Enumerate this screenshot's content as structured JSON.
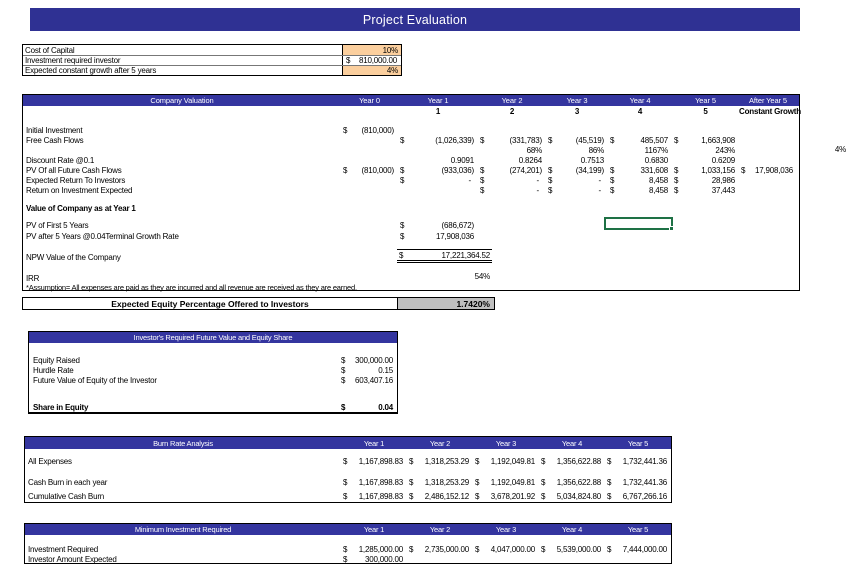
{
  "currency": "$",
  "title_bar": {
    "label": "Project Evaluation"
  },
  "assumptions": {
    "rows": [
      {
        "label": "Cost of Capital",
        "value": "10%"
      },
      {
        "label": "Investment required investor",
        "value": "810,000.00"
      },
      {
        "label": "Expected constant growth after 5 years",
        "value": "4%"
      }
    ]
  },
  "valuation": {
    "title": "Company Valuation",
    "years": [
      "Year 0",
      "Year 1",
      "Year 2",
      "Year 3",
      "Year 4",
      "Year 5",
      "After Year 5"
    ],
    "year_numbers": [
      "1",
      "2",
      "3",
      "4",
      "5"
    ],
    "constant_growth_label": "Constant Growth",
    "initial_investment": {
      "label": "Initial Investment",
      "y0": "(810,000)"
    },
    "free_cash_flows": {
      "label": "Free Cash Flows",
      "y1": "(1,026,339)",
      "y2": "(331,783)",
      "y3": "(45,519)",
      "y4": "485,507",
      "y5": "1,663,908"
    },
    "growth_percents": {
      "y2": "68%",
      "y3": "86%",
      "y4": "1167%",
      "y5": "243%",
      "after": "4%"
    },
    "discount_rate": {
      "label": "Discount Rate @0.1",
      "y1": "0.9091",
      "y2": "0.8264",
      "y3": "0.7513",
      "y4": "0.6830",
      "y5": "0.6209"
    },
    "pv_future": {
      "label": "PV Of all Future Cash Flows",
      "y0": "(810,000)",
      "y1": "(933,036)",
      "y2": "(274,201)",
      "y3": "(34,199)",
      "y4": "331,608",
      "y5": "1,033,156",
      "after": "17,908,036"
    },
    "expected_return": {
      "label": "Expected Return To Investors",
      "y1": "-",
      "y2": "-",
      "y3": "-",
      "y4": "8,458",
      "y5": "28,986"
    },
    "roi_expected": {
      "label": "Return on Investment Expected",
      "y2": "-",
      "y3": "-",
      "y4": "8,458",
      "y5": "37,443"
    },
    "value_heading": "Value of Company as at Year 1",
    "pv_first5": {
      "label": "PV of First 5 Years",
      "y1": "(686,672)"
    },
    "pv_after5": {
      "label": "PV after 5 Years @0.04Terminal Growth Rate",
      "y1": "17,908,036"
    },
    "npw": {
      "label": "NPW Value of the Company",
      "value": "17,221,364.52"
    },
    "irr": {
      "label": "IRR",
      "value": "54%"
    },
    "note": "*Assumption= All expenses are paid as they are incurred and all revenue are received as they are earned."
  },
  "equity_offer": {
    "label": "Expected Equity Percentage Offered to Investors",
    "value": "1.7420%"
  },
  "investor": {
    "title": "Investor's Required Future Value and Equity Share",
    "rows": [
      {
        "label": "Equity Raised",
        "value": "300,000.00"
      },
      {
        "label": "Hurdle Rate",
        "value": "0.15"
      },
      {
        "label": "Future Value of Equity of the Investor",
        "value": "603,407.16"
      }
    ],
    "total": {
      "label": "Share in Equity",
      "value": "0.04"
    }
  },
  "burn_rate": {
    "title": "Burn Rate Analysis",
    "years": [
      "Year 1",
      "Year 2",
      "Year 3",
      "Year 4",
      "Year 5"
    ],
    "rows": [
      {
        "label": "All Expenses",
        "values": [
          "1,167,898.83",
          "1,318,253.29",
          "1,192,049.81",
          "1,356,622.88",
          "1,732,441.36"
        ]
      },
      {
        "label": "Cash Burn in each year",
        "values": [
          "1,167,898.83",
          "1,318,253.29",
          "1,192,049.81",
          "1,356,622.88",
          "1,732,441.36"
        ]
      },
      {
        "label": "Cumulative Cash Burn",
        "values": [
          "1,167,898.83",
          "2,486,152.12",
          "3,678,201.92",
          "5,034,824.80",
          "6,767,266.16"
        ]
      }
    ]
  },
  "min_investment": {
    "title": "Minimum Investment Required",
    "years": [
      "Year 1",
      "Year 2",
      "Year 3",
      "Year 4",
      "Year 5"
    ],
    "rows": [
      {
        "label": "Investment Required",
        "values": [
          "1,285,000.00",
          "2,735,000.00",
          "4,047,000.00",
          "5,539,000.00",
          "7,444,000.00"
        ]
      },
      {
        "label": "Investor Amount Expected",
        "values": [
          "300,000.00",
          "",
          "",
          "",
          ""
        ]
      }
    ]
  }
}
